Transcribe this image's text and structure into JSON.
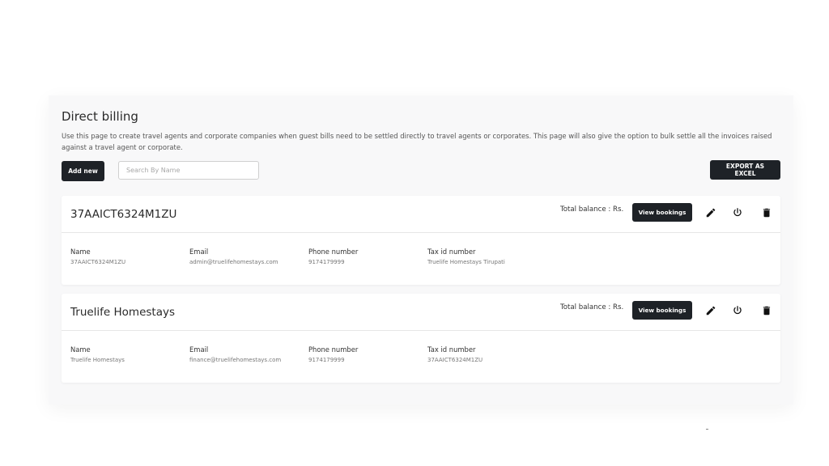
{
  "page": {
    "title": "Direct billing",
    "description": "Use this page to create travel agents and corporate companies when guest bills need to be settled directly to travel agents or corporates. This page will also give the option to bulk settle all the invoices raised against a travel agent or corporate.",
    "add_label": "Add new",
    "search_placeholder": "Search By Name",
    "export_label": "EXPORT AS EXCEL"
  },
  "field_labels": {
    "name": "Name",
    "email": "Email",
    "phone": "Phone number",
    "tax": "Tax id number"
  },
  "cards": [
    {
      "title": "37AAICT6324M1ZU",
      "balance_label": "Total balance : Rs.",
      "view_label": "View bookings",
      "name": "37AAICT6324M1ZU",
      "email": "admin@truelifehomestays.com",
      "phone": "9174179999",
      "tax": "Truelife Homestays Tirupati"
    },
    {
      "title": "Truelife Homestays",
      "balance_label": "Total balance : Rs.",
      "view_label": "View bookings",
      "name": "Truelife Homestays",
      "email": "finance@truelifehomestays.com",
      "phone": "9174179999",
      "tax": "37AAICT6324M1ZU"
    }
  ],
  "icons": [
    "edit-icon",
    "power-icon",
    "delete-icon"
  ],
  "colors": {
    "dark_button": "#1e2227",
    "panel": "#f8f8f9"
  }
}
